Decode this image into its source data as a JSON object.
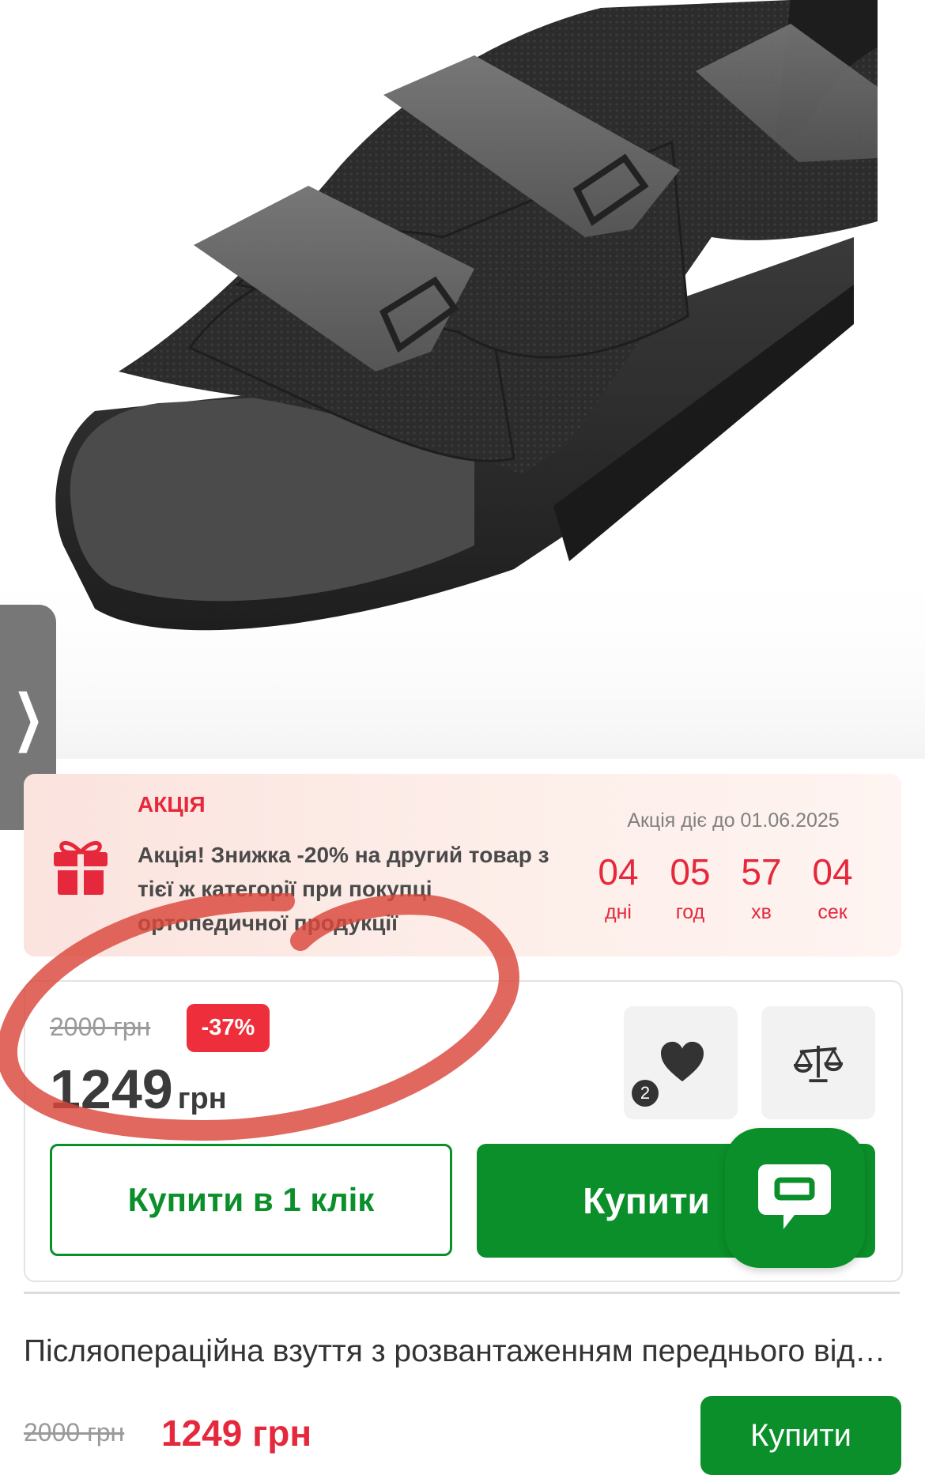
{
  "promo": {
    "label": "АКЦІЯ",
    "text": "Акція! Знижка -20% на другий товар з тієї ж категорії при покупці ортопедичної продукції",
    "deadline": "Акція діє до 01.06.2025",
    "timer": [
      {
        "value": "04",
        "unit": "дні"
      },
      {
        "value": "05",
        "unit": "год"
      },
      {
        "value": "57",
        "unit": "хв"
      },
      {
        "value": "04",
        "unit": "сек"
      }
    ]
  },
  "price": {
    "old": "2000 грн",
    "discount": "-37%",
    "current": "1249",
    "currency": "грн"
  },
  "wishlist": {
    "count": "2"
  },
  "buttons": {
    "buy_one_click": "Купити в 1 клік",
    "buy": "Купити"
  },
  "bottom_bar": {
    "title": "Післяопераційна взуття з розвантаженням переднього відділу стопи",
    "old_price": "2000 грн",
    "price": "1249 грн",
    "buy": "Купити"
  },
  "icons": {
    "gallery_next": "chevron-right-icon",
    "gift": "gift-icon",
    "wishlist": "heart-icon",
    "compare": "scales-icon",
    "chat": "chat-icon"
  },
  "colors": {
    "accent_green": "#0b8f2a",
    "accent_red": "#e5283c",
    "discount_badge": "#ee2e3a"
  }
}
